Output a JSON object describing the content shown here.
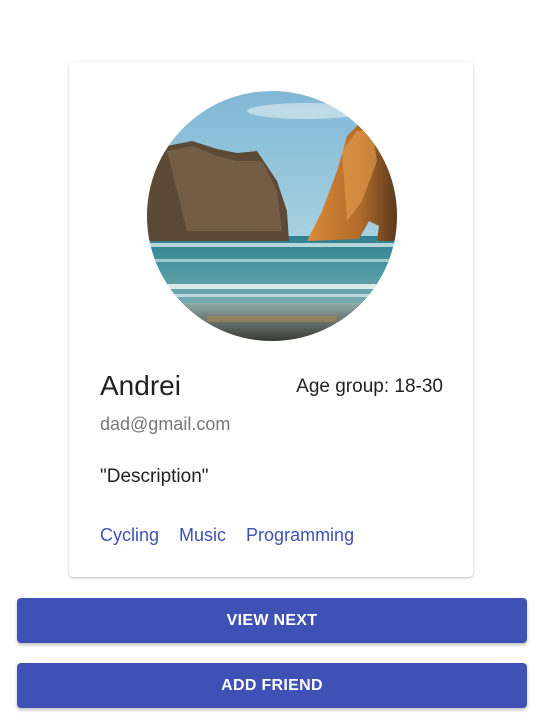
{
  "profile": {
    "avatar": "profile-photo",
    "name": "Andrei",
    "age_group": "Age group: 18-30",
    "email": "dad@gmail.com",
    "description": "\"Description\"",
    "interests": [
      "Cycling",
      "Music",
      "Programming"
    ]
  },
  "actions": {
    "view_next": "VIEW NEXT",
    "add_friend": "ADD FRIEND"
  },
  "colors": {
    "primary": "#3f51b5",
    "text": "#222222",
    "muted": "#777777"
  }
}
